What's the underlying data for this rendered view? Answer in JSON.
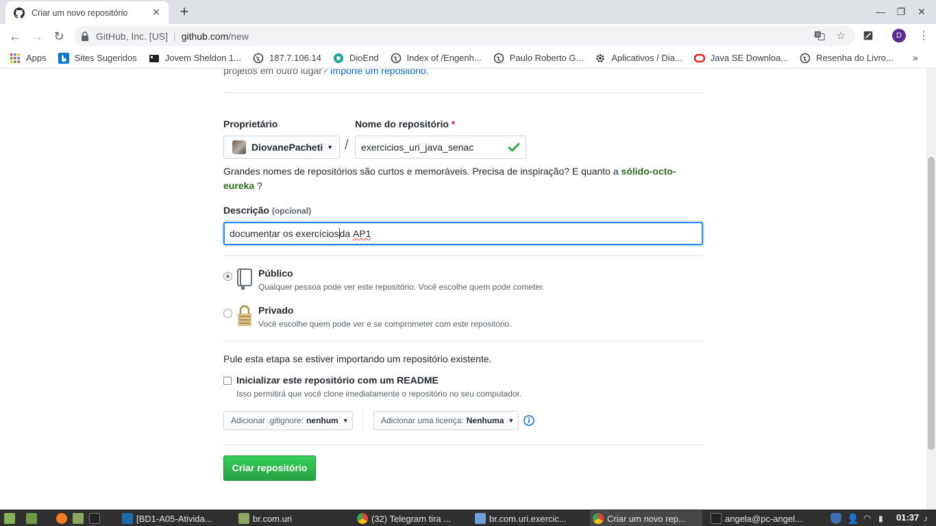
{
  "browser": {
    "tab_title": "Criar um novo repositório",
    "tab_close": "✕",
    "newtab": "+",
    "win_min": "—",
    "win_max": "❐",
    "win_close": "✕",
    "site_org": "GitHub, Inc. [US]",
    "url_host": "github.com",
    "url_path": "/new",
    "profile_initial": "D",
    "bookmarks": [
      {
        "label": "Apps",
        "icon": "apps-grid-icon"
      },
      {
        "label": "Sites Sugeridos",
        "icon": "bing-icon"
      },
      {
        "label": "Jovem Sheldon 1...",
        "icon": "film-icon"
      },
      {
        "label": "187.7.106.14",
        "icon": "globe-icon"
      },
      {
        "label": "DioEnd",
        "icon": "dio-icon"
      },
      {
        "label": "Index of /Engenh...",
        "icon": "globe-icon"
      },
      {
        "label": "Paulo Roberto G...",
        "icon": "globe-icon"
      },
      {
        "label": "Aplicativos / Dia...",
        "icon": "gear-icon"
      },
      {
        "label": "Java SE Downloa...",
        "icon": "oracle-icon"
      },
      {
        "label": "Resenha do Livro...",
        "icon": "globe-icon"
      }
    ],
    "bookmarks_more": "»"
  },
  "page": {
    "intro_text": "projetos em outro lugar?",
    "intro_link": "Importe um repositório.",
    "owner_label": "Proprietário",
    "owner_value": "DiovanePacheti",
    "repo_label": "Nome do repositório",
    "required_mark": "*",
    "slash": "/",
    "repo_value": "exercicios_uri_java_senac",
    "hint_text": "Grandes nomes de repositórios são curtos e memoráveis. Precisa de inspiração? E quanto a",
    "hint_suggestion": "sólido-octo-eureka",
    "hint_end": "?",
    "desc_label": "Descrição",
    "desc_optional": "(opcional)",
    "desc_value_before": "documentar os exercícios",
    "desc_value_mid": "da ",
    "desc_value_spell": "AP1",
    "public_title": "Público",
    "public_desc": "Qualquer pessoa pode ver este repositório. Você escolhe quem pode cometer.",
    "private_title": "Privado",
    "private_desc": "Você escolhe quem pode ver e se comprometer com este repositório.",
    "skip_text": "Pule esta etapa se estiver importando um repositório existente.",
    "readme_label": "Inicializar este repositório com um README",
    "readme_desc": "Isso permitirá que você clone imediatamente o repositório no seu computador.",
    "gitignore_label": "Adicionar .gitignore:",
    "gitignore_value": "nenhum",
    "license_label": "Adicionar uma licença:",
    "license_value": "Nenhuma",
    "create_button": "Criar repositório",
    "visibility_selected": "public",
    "readme_checked": false
  },
  "taskbar": {
    "tasks": [
      {
        "label": "[BD1-A05-Ativida...",
        "icon": "mysql-workbench-icon"
      },
      {
        "label": "br.com.uri",
        "icon": "folder-icon"
      },
      {
        "label": "(32) Telegram tira ...",
        "icon": "chrome-icon"
      },
      {
        "label": "br.com.uri.exercic...",
        "icon": "netbeans-icon"
      },
      {
        "label": "Criar um novo rep...",
        "icon": "chrome-icon"
      },
      {
        "label": "angela@pc-angel...",
        "icon": "terminal-icon"
      }
    ],
    "clock": "01:37"
  },
  "colors": {
    "accent_blue": "#0366d6",
    "create_green": "#28a745",
    "suggest_green": "#2c6e1f",
    "required_red": "#cb2431",
    "profile_purple": "#5c2d91"
  }
}
